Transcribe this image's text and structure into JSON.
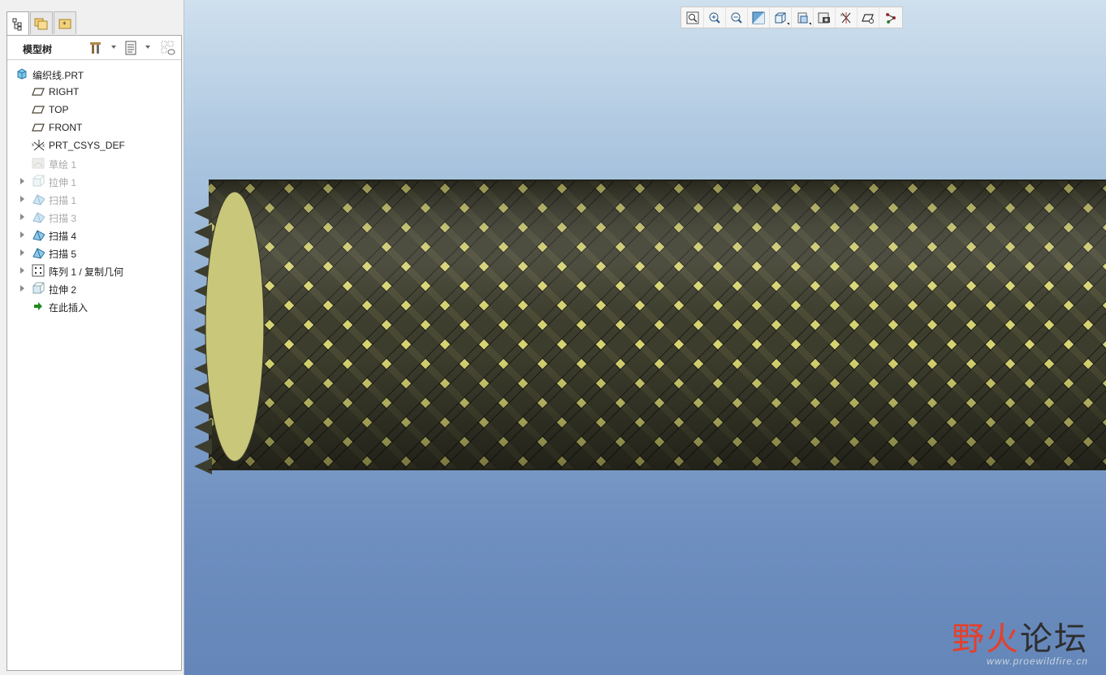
{
  "model_tree": {
    "tabs": [
      {
        "name": "model-tree",
        "active": true
      },
      {
        "name": "folder-browser",
        "active": false
      },
      {
        "name": "favorites",
        "active": false
      }
    ],
    "title": "模型树",
    "items": [
      {
        "label": "编织线.PRT",
        "icon": "part-icon",
        "expandable": false,
        "dim": false,
        "level": 0
      },
      {
        "label": "RIGHT",
        "icon": "datum-plane-icon",
        "expandable": false,
        "dim": false,
        "level": 1
      },
      {
        "label": "TOP",
        "icon": "datum-plane-icon",
        "expandable": false,
        "dim": false,
        "level": 1
      },
      {
        "label": "FRONT",
        "icon": "datum-plane-icon",
        "expandable": false,
        "dim": false,
        "level": 1
      },
      {
        "label": "PRT_CSYS_DEF",
        "icon": "csys-icon",
        "expandable": false,
        "dim": false,
        "level": 1
      },
      {
        "label": "草绘 1",
        "icon": "sketch-icon",
        "expandable": false,
        "dim": true,
        "level": 1
      },
      {
        "label": "拉伸 1",
        "icon": "extrude-icon",
        "expandable": true,
        "dim": true,
        "level": 1
      },
      {
        "label": "扫描 1",
        "icon": "sweep-icon",
        "expandable": true,
        "dim": true,
        "level": 1
      },
      {
        "label": "扫描 3",
        "icon": "sweep-icon",
        "expandable": true,
        "dim": true,
        "level": 1
      },
      {
        "label": "扫描 4",
        "icon": "sweep-icon",
        "expandable": true,
        "dim": false,
        "level": 1
      },
      {
        "label": "扫描 5",
        "icon": "sweep-icon",
        "expandable": true,
        "dim": false,
        "level": 1
      },
      {
        "label": "阵列 1 / 复制几何",
        "icon": "pattern-icon",
        "expandable": true,
        "dim": false,
        "level": 1
      },
      {
        "label": "拉伸 2",
        "icon": "extrude-icon",
        "expandable": true,
        "dim": false,
        "level": 1
      },
      {
        "label": "在此插入",
        "icon": "insert-here-arrow-icon",
        "expandable": false,
        "dim": false,
        "level": 1
      }
    ]
  },
  "view_toolbar": [
    "refit-icon",
    "zoom-in-icon",
    "zoom-out-icon",
    "repaint-icon",
    "saved-orientations-icon",
    "display-style-icon",
    "view-manager-icon",
    "datum-display-icon",
    "spin-center-icon",
    "annotation-display-icon",
    "feature-display-icon"
  ],
  "colors": {
    "braid_dark": "#3d3d2e",
    "braid_gap": "#d7d472",
    "end_cap": "#c9c77a",
    "accent_red": "#e5402a"
  },
  "watermark": {
    "title_red": "野火",
    "title_dark": "论坛",
    "url": "www.proewildfire.cn"
  }
}
